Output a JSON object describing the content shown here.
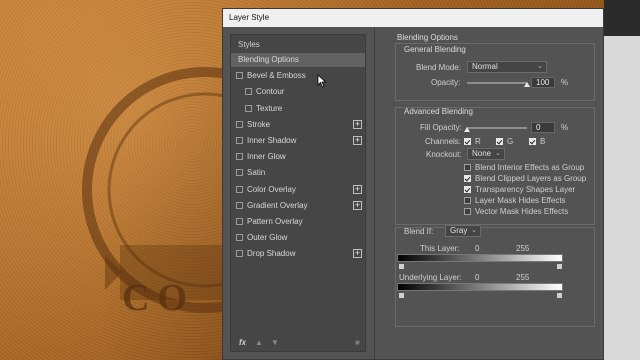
{
  "dialog": {
    "title": "Layer Style"
  },
  "styles_panel": {
    "header": "Styles",
    "items": [
      {
        "label": "Blending Options",
        "checkbox": false,
        "selected": true,
        "indent": false,
        "plus": false
      },
      {
        "label": "Bevel & Emboss",
        "checkbox": true,
        "checked": false,
        "indent": false,
        "plus": false
      },
      {
        "label": "Contour",
        "checkbox": true,
        "checked": false,
        "indent": true,
        "plus": false
      },
      {
        "label": "Texture",
        "checkbox": true,
        "checked": false,
        "indent": true,
        "plus": false
      },
      {
        "label": "Stroke",
        "checkbox": true,
        "checked": false,
        "indent": false,
        "plus": true
      },
      {
        "label": "Inner Shadow",
        "checkbox": true,
        "checked": false,
        "indent": false,
        "plus": true
      },
      {
        "label": "Inner Glow",
        "checkbox": true,
        "checked": false,
        "indent": false,
        "plus": false
      },
      {
        "label": "Satin",
        "checkbox": true,
        "checked": false,
        "indent": false,
        "plus": false
      },
      {
        "label": "Color Overlay",
        "checkbox": true,
        "checked": false,
        "indent": false,
        "plus": true
      },
      {
        "label": "Gradient Overlay",
        "checkbox": true,
        "checked": false,
        "indent": false,
        "plus": true
      },
      {
        "label": "Pattern Overlay",
        "checkbox": true,
        "checked": false,
        "indent": false,
        "plus": false
      },
      {
        "label": "Outer Glow",
        "checkbox": true,
        "checked": false,
        "indent": false,
        "plus": false
      },
      {
        "label": "Drop Shadow",
        "checkbox": true,
        "checked": false,
        "indent": false,
        "plus": true
      }
    ],
    "footer": {
      "fx_label": "fx"
    }
  },
  "blending": {
    "section_title": "Blending Options",
    "general": {
      "title": "General Blending",
      "blend_mode_label": "Blend Mode:",
      "blend_mode_value": "Normal",
      "opacity_label": "Opacity:",
      "opacity_value": "100",
      "opacity_unit": "%",
      "opacity_fraction": 1.0
    },
    "advanced": {
      "title": "Advanced Blending",
      "fill_opacity_label": "Fill Opacity:",
      "fill_opacity_value": "0",
      "fill_opacity_unit": "%",
      "fill_opacity_fraction": 0.0,
      "channels_label": "Channels:",
      "channels": [
        {
          "label": "R",
          "checked": true
        },
        {
          "label": "G",
          "checked": true
        },
        {
          "label": "B",
          "checked": true
        }
      ],
      "knockout_label": "Knockout:",
      "knockout_value": "None",
      "options": [
        {
          "label": "Blend Interior Effects as Group",
          "checked": false
        },
        {
          "label": "Blend Clipped Layers as Group",
          "checked": true
        },
        {
          "label": "Transparency Shapes Layer",
          "checked": true
        },
        {
          "label": "Layer Mask Hides Effects",
          "checked": false
        },
        {
          "label": "Vector Mask Hides Effects",
          "checked": false
        }
      ]
    },
    "blend_if": {
      "label": "Blend If:",
      "value": "Gray",
      "this_layer_label": "This Layer:",
      "this_layer_low": "0",
      "this_layer_high": "255",
      "underlying_label": "Underlying Layer:",
      "underlying_low": "0",
      "underlying_high": "255"
    }
  },
  "background": {
    "emblem_text": "CO"
  },
  "colors": {
    "dialog_bg": "#535353",
    "panel_bg": "#464646",
    "selected_bg": "#626262",
    "leather": "#a4621f"
  }
}
